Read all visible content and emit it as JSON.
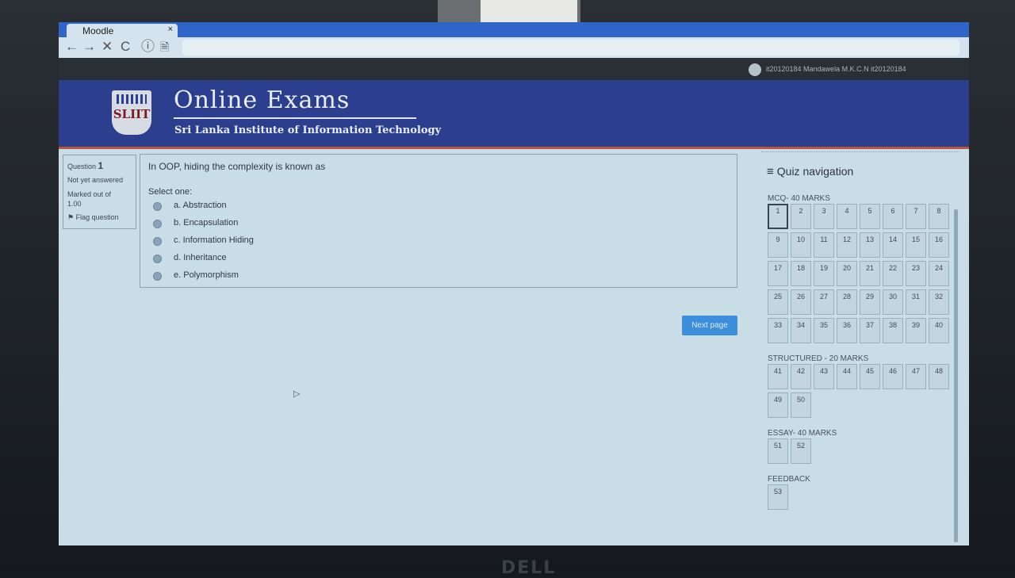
{
  "browser": {
    "tab_title": "Moodle",
    "tab_close": "×",
    "back": "←",
    "forward": "→",
    "stop": "✕",
    "reload": "C",
    "info": "ⓘ",
    "page_icon": "🗎"
  },
  "header": {
    "user_name": "it20120184 Mandawela M.K.C.N it20120184",
    "site_title": "Online Exams",
    "site_subtitle": "Sri Lanka Institute of Information Technology",
    "logo_text": "SLIIT"
  },
  "question_info": {
    "label": "Question",
    "number": "1",
    "status": "Not yet answered",
    "marked_out_of_label": "Marked out of",
    "marked_out_of_value": "1.00",
    "flag": "Flag question"
  },
  "question": {
    "text": "In OOP, hiding the complexity is known as",
    "select_one": "Select one:",
    "options": [
      {
        "label": "a. Abstraction"
      },
      {
        "label": "b. Encapsulation"
      },
      {
        "label": "c. Information Hiding"
      },
      {
        "label": "d. Inheritance"
      },
      {
        "label": "e. Polymorphism"
      }
    ]
  },
  "next_page": "Next page",
  "quiz_nav": {
    "title": "Quiz navigation",
    "current_question": 1,
    "sections": [
      {
        "label": "MCQ- 40 MARKS",
        "questions": [
          "1",
          "2",
          "3",
          "4",
          "5",
          "6",
          "7",
          "8",
          "9",
          "10",
          "11",
          "12",
          "13",
          "14",
          "15",
          "16",
          "17",
          "18",
          "19",
          "20",
          "21",
          "22",
          "23",
          "24",
          "25",
          "26",
          "27",
          "28",
          "29",
          "30",
          "31",
          "32",
          "33",
          "34",
          "35",
          "36",
          "37",
          "38",
          "39",
          "40"
        ]
      },
      {
        "label": "STRUCTURED - 20 MARKS",
        "questions": [
          "41",
          "42",
          "43",
          "44",
          "45",
          "46",
          "47",
          "48",
          "49",
          "50"
        ]
      },
      {
        "label": "ESSAY- 40 MARKS",
        "questions": [
          "51",
          "52"
        ]
      },
      {
        "label": "FEEDBACK",
        "questions": [
          "53"
        ]
      }
    ]
  },
  "device": {
    "brand": "DELL"
  }
}
